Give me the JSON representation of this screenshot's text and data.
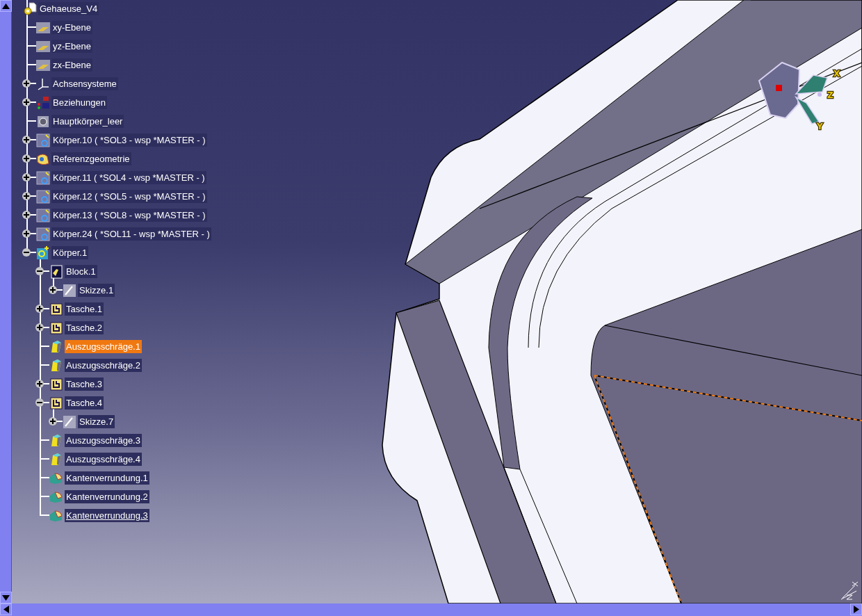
{
  "tree": {
    "label": "Gehaeuse_V4",
    "kind": "part",
    "selected": false,
    "in_work": false,
    "children": [
      {
        "label": "xy-Ebene",
        "kind": "plane",
        "selected": false,
        "in_work": false
      },
      {
        "label": "yz-Ebene",
        "kind": "plane",
        "selected": false,
        "in_work": false
      },
      {
        "label": "zx-Ebene",
        "kind": "plane",
        "selected": false,
        "in_work": false
      },
      {
        "label": "Achsensysteme",
        "kind": "axis",
        "selected": false,
        "in_work": false,
        "expanded": false
      },
      {
        "label": "Beziehungen",
        "kind": "relations",
        "selected": false,
        "in_work": false,
        "expanded": false
      },
      {
        "label": "Hauptkörper_leer",
        "kind": "mainbody",
        "selected": false,
        "in_work": false
      },
      {
        "label": "Körper.10 ( *SOL3 - wsp *MASTER -  )",
        "kind": "body",
        "selected": false,
        "in_work": false,
        "expanded": false
      },
      {
        "label": "Referenzgeometrie",
        "kind": "geoset",
        "selected": false,
        "in_work": false,
        "expanded": false
      },
      {
        "label": "Körper.11 ( *SOL4 - wsp *MASTER -  )",
        "kind": "body",
        "selected": false,
        "in_work": false,
        "expanded": false
      },
      {
        "label": "Körper.12 ( *SOL5 - wsp *MASTER -  )",
        "kind": "body",
        "selected": false,
        "in_work": false,
        "expanded": false
      },
      {
        "label": "Körper.13 ( *SOL8 - wsp *MASTER -  )",
        "kind": "body",
        "selected": false,
        "in_work": false,
        "expanded": false
      },
      {
        "label": "Körper.24 ( *SOL11 - wsp *MASTER -  )",
        "kind": "body",
        "selected": false,
        "in_work": false,
        "expanded": false
      },
      {
        "label": "Körper.1",
        "kind": "activebody",
        "selected": false,
        "in_work": false,
        "expanded": true,
        "children": [
          {
            "label": "Block.1",
            "kind": "pad",
            "selected": false,
            "in_work": false,
            "expanded": true,
            "children": [
              {
                "label": "Skizze.1",
                "kind": "sketch",
                "selected": false,
                "in_work": false,
                "expanded": false
              }
            ]
          },
          {
            "label": "Tasche.1",
            "kind": "pocket",
            "selected": false,
            "in_work": false,
            "expanded": false
          },
          {
            "label": "Tasche.2",
            "kind": "pocket",
            "selected": false,
            "in_work": false,
            "expanded": false
          },
          {
            "label": "Auszugsschräge.1",
            "kind": "draft",
            "selected": true,
            "in_work": false
          },
          {
            "label": "Auszugsschräge.2",
            "kind": "draft",
            "selected": false,
            "in_work": false
          },
          {
            "label": "Tasche.3",
            "kind": "pocket",
            "selected": false,
            "in_work": false,
            "expanded": false
          },
          {
            "label": "Tasche.4",
            "kind": "pocket",
            "selected": false,
            "in_work": false,
            "expanded": true,
            "children": [
              {
                "label": "Skizze.7",
                "kind": "sketch",
                "selected": false,
                "in_work": false,
                "expanded": false
              }
            ]
          },
          {
            "label": "Auszugsschräge.3",
            "kind": "draft",
            "selected": false,
            "in_work": false
          },
          {
            "label": "Auszugsschräge.4",
            "kind": "draft",
            "selected": false,
            "in_work": false
          },
          {
            "label": "Kantenverrundung.1",
            "kind": "fillet",
            "selected": false,
            "in_work": false
          },
          {
            "label": "Kantenverrundung.2",
            "kind": "fillet",
            "selected": false,
            "in_work": false
          },
          {
            "label": "Kantenverrundung.3",
            "kind": "fillet",
            "selected": false,
            "in_work": true
          }
        ]
      }
    ]
  },
  "compass": {
    "labels": [
      "X",
      "Z",
      "Y"
    ]
  }
}
